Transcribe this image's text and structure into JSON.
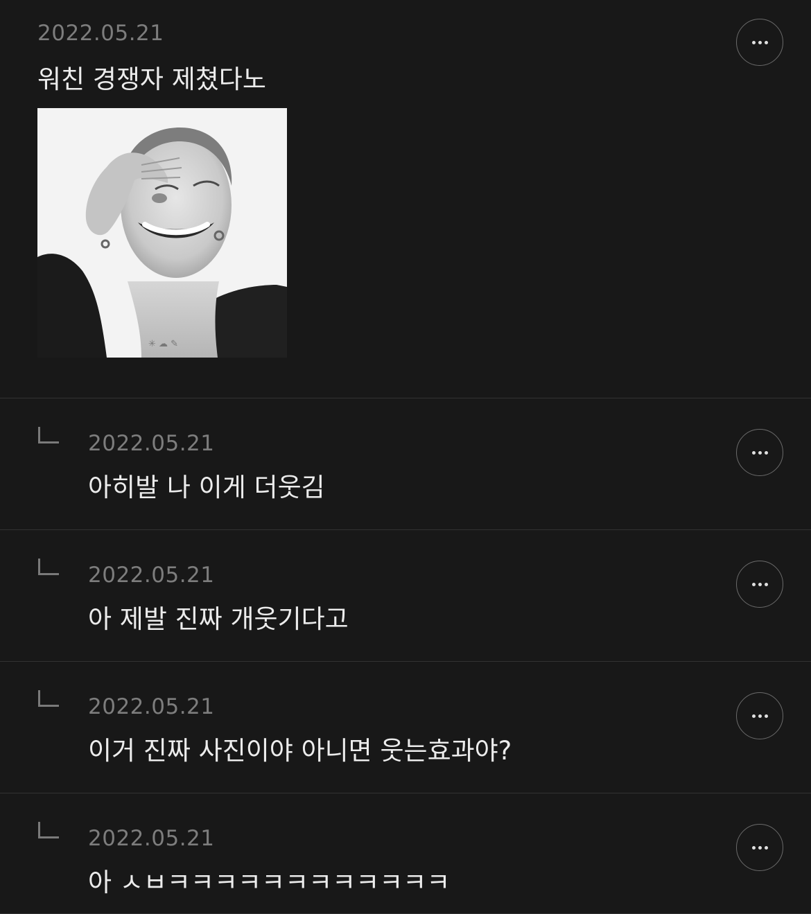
{
  "post": {
    "date": "2022.05.21",
    "text": "워친 경쟁자 제쳤다노",
    "image_alt": "smiling person photo"
  },
  "replies": [
    {
      "date": "2022.05.21",
      "text": "아히발 나 이게 더웃김"
    },
    {
      "date": "2022.05.21",
      "text": "아 제발 진짜 개웃기다고"
    },
    {
      "date": "2022.05.21",
      "text": "이거 진짜 사진이야 아니면 웃는효과야?"
    },
    {
      "date": "2022.05.21",
      "text": "아 ㅅㅂㅋㅋㅋㅋㅋㅋㅋㅋㅋㅋㅋㅋ"
    }
  ],
  "icons": {
    "more": "more-horizontal-icon",
    "reply": "reply-corner-icon"
  },
  "colors": {
    "background": "#181818",
    "divider": "#333333",
    "date": "#7d7d7d",
    "text": "#ececec"
  }
}
